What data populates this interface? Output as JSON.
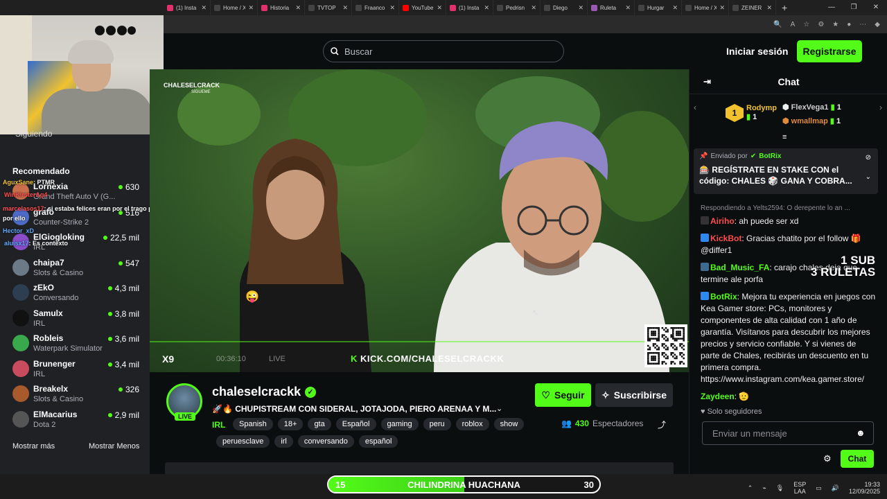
{
  "browser": {
    "tabs": [
      {
        "label": "(1) Insta",
        "icon": "instagram-icon",
        "color": "#e1306c"
      },
      {
        "label": "Home / X",
        "icon": "x-icon",
        "color": "#444"
      },
      {
        "label": "Historia",
        "icon": "instagram-icon",
        "color": "#e1306c"
      },
      {
        "label": "TVTOP",
        "icon": "x-icon",
        "color": "#444"
      },
      {
        "label": "Fraanco",
        "icon": "x-icon",
        "color": "#444"
      },
      {
        "label": "YouTube",
        "icon": "youtube-icon",
        "color": "#ff0000"
      },
      {
        "label": "(1) Insta",
        "icon": "instagram-icon",
        "color": "#e1306c"
      },
      {
        "label": "Pedrisn",
        "icon": "x-icon",
        "color": "#444"
      },
      {
        "label": "Diego",
        "icon": "tiktok-icon",
        "color": "#444"
      },
      {
        "label": "Ruleta",
        "icon": "ruleta-icon",
        "color": "#9b59b6"
      },
      {
        "label": "Hurgar",
        "icon": "x-icon",
        "color": "#444"
      },
      {
        "label": "Home / X",
        "icon": "x-icon",
        "color": "#444"
      },
      {
        "label": "ZEINER",
        "icon": "x-icon",
        "color": "#444"
      }
    ]
  },
  "header": {
    "search_placeholder": "Buscar",
    "login": "Iniciar sesión",
    "register": "Registrarse"
  },
  "webcam_overlay": {
    "messages": [
      {
        "user": "AguxSane",
        "text": ": PTMR",
        "color": "#f1c22e"
      },
      {
        "user": "WinKirsterAg4",
        "text": "",
        "color": "#ff4d4d"
      },
      {
        "user": "marcelasos17",
        "text": ": si estaba felices eran por el trago pa no",
        "color": "#ff4d4d"
      },
      {
        "user": "por ello",
        "text": "",
        "color": "#fff"
      },
      {
        "user": "Hector_xD",
        "text": "",
        "color": "#5ea8ff"
      },
      {
        "user": "aluisx17",
        "text": ": Es contexto",
        "color": "#5ea8ff"
      }
    ]
  },
  "sidebar": {
    "following": "Siguiendo",
    "recommended": "Recomendado",
    "items": [
      {
        "name": "Lornexia",
        "category": "Grand Theft Auto V (G...",
        "viewers": "630",
        "avatar": "#c96f4c"
      },
      {
        "name": "grafo",
        "category": "Counter-Strike 2",
        "viewers": "516",
        "avatar": "#4c6bc9"
      },
      {
        "name": "ElGiogloking",
        "category": "IRL",
        "viewers": "22,5 mil",
        "avatar": "#8a4cc9"
      },
      {
        "name": "chaipa7",
        "category": "Slots & Casino",
        "viewers": "547",
        "avatar": "#6b7a86"
      },
      {
        "name": "zEkO",
        "category": "Conversando",
        "viewers": "4,3 mil",
        "avatar": "#2c3e50"
      },
      {
        "name": "Samulx",
        "category": "IRL",
        "viewers": "3,8 mil",
        "avatar": "#111"
      },
      {
        "name": "Robleis",
        "category": "Waterpark Simulator",
        "viewers": "3,6 mil",
        "avatar": "#3aa84c"
      },
      {
        "name": "Brunenger",
        "category": "IRL",
        "viewers": "3,4 mil",
        "avatar": "#c94c5e"
      },
      {
        "name": "Breakelx",
        "category": "Slots & Casino",
        "viewers": "326",
        "avatar": "#a85a2c"
      },
      {
        "name": "ElMacarius",
        "category": "Dota 2",
        "viewers": "2,9 mil",
        "avatar": "#555"
      }
    ],
    "show_more": "Mostrar más",
    "show_less": "Mostrar Menos"
  },
  "video": {
    "watermark": "CHALESELCRACK",
    "watermark_sub": "SÍGUEME",
    "kick_url": "KICK.COM/CHALESELCRACKK",
    "x9": "X9",
    "time": "00:36:10",
    "live": "LIVE"
  },
  "stream": {
    "streamer": "chaleselcrackk",
    "live_badge": "LIVE",
    "title": "🚀🔥 CHUPISTREAM CON SIDERAL, JOTAJODA, PIERO ARENAA Y M...",
    "category": "IRL",
    "tags": [
      "Spanish",
      "18+",
      "gta",
      "Español",
      "gaming",
      "peru",
      "roblox",
      "show"
    ],
    "tags2": [
      "peruesclave",
      "irl",
      "conversando",
      "español"
    ],
    "follow": "Seguir",
    "subscribe": "Suscribirse",
    "viewers": "430",
    "viewers_label": "Espectadores"
  },
  "chat": {
    "title": "Chat",
    "leaderboard": {
      "rank": "1",
      "users": [
        {
          "name": "Rodymp",
          "count": "1",
          "color": "#f1c22e"
        },
        {
          "name": "FlexVega1",
          "count": "1",
          "color": "#cfcfcf"
        },
        {
          "name": "wmallmap",
          "count": "1",
          "color": "#e08a3c"
        }
      ]
    },
    "pinned": {
      "sent_by": "Enviado por",
      "author": "BotRix",
      "text": "🎰 REGÍSTRATE EN STAKE CON el código: CHALES 🎲 GANA Y COBRA..."
    },
    "messages": [
      {
        "reply": "Respondiendo a Yelts2594: O derepente lo an ...",
        "user": "Airiho",
        "color": "#ff4d4d",
        "text": ": ah puede ser xd",
        "badge": "#333"
      },
      {
        "user": "KickBot",
        "color": "#ff4d4d",
        "text": ": Gracias chatito por el follow 🎁 @differ1",
        "badge": "#2d89ef"
      },
      {
        "user": "Bad_Music_FA",
        "color": "#53fc18",
        "text": ": carajo chales deja que termine ale porfa",
        "badge": "#3c6b8f"
      },
      {
        "user": "BotRix",
        "color": "#53fc18",
        "text": ": Mejora tu experiencia en juegos con Kea Gamer store: PCs, monitores y componentes de alta calidad con 1 año de garantía. Visítanos para descubrir los mejores precios y servicio confiable. Y si vienes de parte de Chales, recibirás un descuento en tu primera compra. https://www.instagram.com/kea.gamer.store/",
        "badge": "#2d89ef"
      },
      {
        "user": "Zaydeen",
        "color": "#53fc18",
        "text": ": 🫡",
        "badge": ""
      }
    ],
    "followers_only": "Solo seguidores",
    "input_placeholder": "Enviar un mensaje",
    "send": "Chat",
    "overlay_line1": "1 SUB",
    "overlay_line2": "3 RULETAS"
  },
  "goal": {
    "current": "15",
    "label": "CHILINDRINA HUACHANA",
    "target": "30",
    "fraction": 0.5
  },
  "taskbar": {
    "lang1": "ESP",
    "lang2": "LAA",
    "time": "19:33",
    "date": "12/09/2025"
  }
}
